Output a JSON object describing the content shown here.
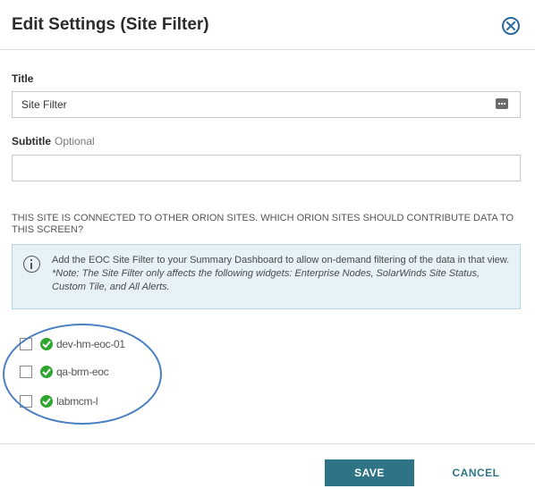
{
  "dialog": {
    "title": "Edit Settings (Site Filter)",
    "close_icon": "close-circle-icon"
  },
  "title_field": {
    "label": "Title",
    "value": "Site Filter",
    "macro_icon": "ellipsis-icon"
  },
  "subtitle_field": {
    "label": "Subtitle",
    "optional_label": "Optional",
    "value": ""
  },
  "sites": {
    "question": "THIS SITE IS CONNECTED TO OTHER ORION SITES. WHICH ORION SITES SHOULD CONTRIBUTE DATA TO THIS SCREEN?",
    "info": {
      "icon": "info-icon",
      "text": "Add the EOC Site Filter to your Summary Dashboard to allow on-demand filtering of the data in that view.",
      "note": "*Note: The Site Filter only affects the following widgets: Enterprise Nodes, SolarWinds Site Status, Custom Tile, and All Alerts."
    },
    "items": [
      {
        "name": "dev-hm-eoc-01",
        "checked": false,
        "status": "ok"
      },
      {
        "name": "qa-brm-eoc",
        "checked": false,
        "status": "ok"
      },
      {
        "name": "labmcm-l",
        "checked": false,
        "status": "ok"
      }
    ]
  },
  "footer": {
    "save_label": "SAVE",
    "cancel_label": "CANCEL"
  },
  "colors": {
    "primary": "#2f7386",
    "info_bg": "#e6f2f7",
    "status_ok": "#2fa62f",
    "highlight": "#4a7fc1"
  }
}
